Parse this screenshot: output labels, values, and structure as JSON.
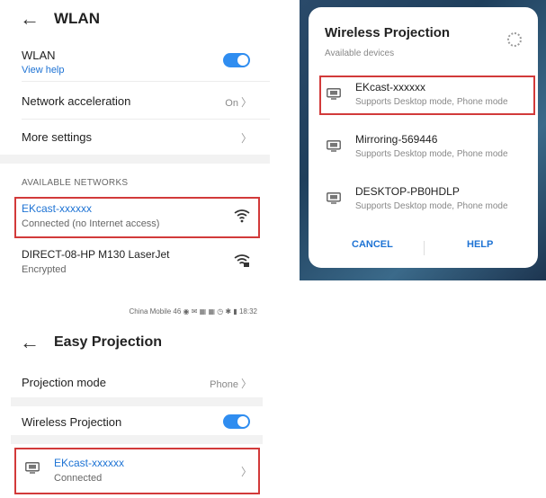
{
  "wlan": {
    "title": "WLAN",
    "wlan_label": "WLAN",
    "view_help": "View help",
    "network_acceleration": "Network acceleration",
    "network_acceleration_value": "On",
    "more_settings": "More settings",
    "section_label": "AVAILABLE NETWORKS",
    "networks": [
      {
        "name": "EKcast-xxxxxx",
        "status": "Connected (no Internet access)"
      },
      {
        "name": "DIRECT-08-HP M130 LaserJet",
        "status": "Encrypted"
      }
    ],
    "toggle_on": true
  },
  "wireless_projection": {
    "title": "Wireless Projection",
    "subtitle": "Available devices",
    "devices": [
      {
        "name": "EKcast-xxxxxx",
        "desc": "Supports Desktop mode, Phone mode"
      },
      {
        "name": "Mirroring-569446",
        "desc": "Supports Desktop mode, Phone mode"
      },
      {
        "name": "DESKTOP-PB0HDLP",
        "desc": "Supports Desktop mode, Phone mode"
      }
    ],
    "cancel": "CANCEL",
    "help": "HELP"
  },
  "easy_projection": {
    "status_bar": "China Mobile 46 ◉ ✉ ▦ ▦ ◷ ✱ ▮ 18:32",
    "title": "Easy Projection",
    "projection_mode": "Projection mode",
    "projection_mode_value": "Phone",
    "wireless_projection": "Wireless Projection",
    "connected_device": {
      "name": "EKcast-xxxxxx",
      "status": "Connected"
    }
  },
  "colors": {
    "accent": "#1e73d4",
    "toggle": "#2f8df0",
    "highlight": "#d23a3a"
  }
}
